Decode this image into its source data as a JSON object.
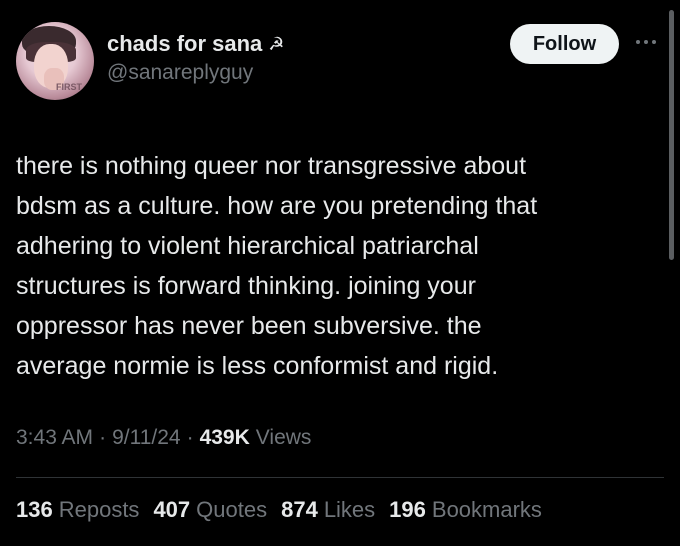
{
  "user": {
    "display_name": "chads for sana",
    "name_emoji": "☭",
    "handle": "@sanareplyguy"
  },
  "follow_label": "Follow",
  "tweet": {
    "lines": [
      "there is nothing queer nor transgressive about",
      "bdsm as a culture. how are you pretending that",
      "adhering to violent hierarchical patriarchal",
      "structures is forward thinking. joining your",
      "oppressor has never been subversive. the",
      "average normie is less conformist and rigid."
    ]
  },
  "meta": {
    "time": "3:43 AM",
    "dot1": "·",
    "date": "9/11/24",
    "dot2": "·",
    "views_count": "439K",
    "views_label": "Views"
  },
  "stats": {
    "reposts": {
      "count": "136",
      "label": "Reposts"
    },
    "quotes": {
      "count": "407",
      "label": "Quotes"
    },
    "likes": {
      "count": "874",
      "label": "Likes"
    },
    "bookmarks": {
      "count": "196",
      "label": "Bookmarks"
    }
  },
  "avatar_text": "FIRST",
  "colors": {
    "background": "#000000",
    "text_primary": "#e7e9ea",
    "text_secondary": "#71767b",
    "button_bg": "#eff3f4"
  }
}
